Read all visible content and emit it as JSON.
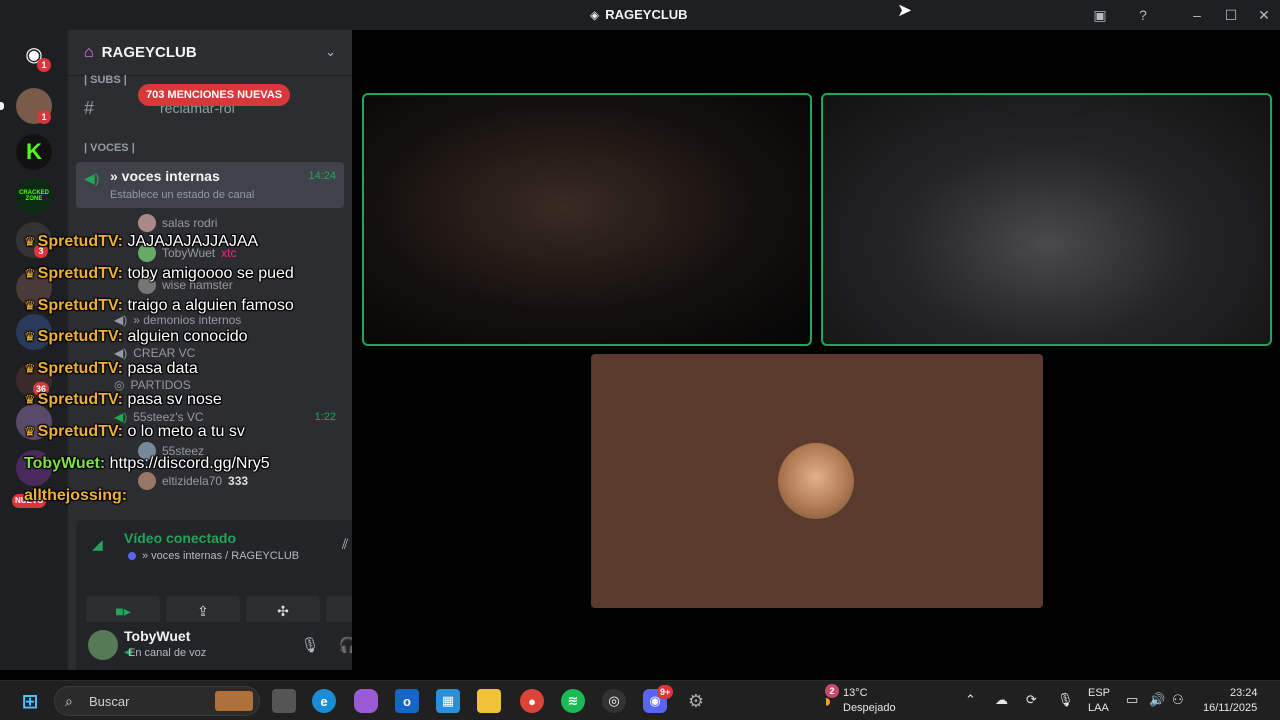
{
  "window": {
    "title": "RAGEYCLUB"
  },
  "guild": {
    "name": "RAGEYCLUB"
  },
  "rail": {
    "badges": [
      "1",
      "1",
      "3",
      "36"
    ],
    "new_label": "NUEVO",
    "cracked_label": "CRACKED ZONE"
  },
  "sidebar": {
    "cat_subs": "| SUBS |",
    "mentions_pill": "703 MENCIONES NUEVAS",
    "hidden_channel": "reclamar-rol",
    "cat_voces": "| VOCES |",
    "active_channel": {
      "name": "» voces internas",
      "time": "14:24",
      "status": "Establece un estado de canal"
    },
    "members": [
      "salas rodri",
      "TobyWuet",
      "wise hamster"
    ],
    "member_tag": "xtc",
    "channels": [
      "» demonios internos",
      "CREAR VC",
      "PARTIDOS",
      "55steez's VC"
    ],
    "vc_time": "1:22",
    "vc_members": [
      "55steez",
      "eltizidela70"
    ],
    "vc_count": "333"
  },
  "chat": [
    {
      "user": "SpretudTV:",
      "text": "JAJAJAJAJJAJAA"
    },
    {
      "user": "SpretudTV:",
      "text": "toby amigoooo se pued"
    },
    {
      "user": "SpretudTV:",
      "text": "traigo a alguien famoso"
    },
    {
      "user": "SpretudTV:",
      "text": "alguien conocido"
    },
    {
      "user": "SpretudTV:",
      "text": "pasa data"
    },
    {
      "user": "SpretudTV:",
      "text": "pasa sv nose"
    },
    {
      "user": "SpretudTV:",
      "text": "o lo meto a tu sv"
    },
    {
      "user": "TobyWuet:",
      "text": "https://discord.gg/Nry5"
    },
    {
      "user": "allthejossing:",
      "text": ""
    }
  ],
  "voice": {
    "connected": "Vídeo conectado",
    "location": "» voces internas / RAGEYCLUB"
  },
  "user": {
    "name": "TobyWuet",
    "status": "En canal de voz"
  },
  "taskbar": {
    "search_placeholder": "Buscar",
    "weather_temp": "13°C",
    "weather_desc": "Despejado",
    "weather_badge": "2",
    "lang_top": "ESP",
    "lang_bottom": "LAA",
    "time": "23:24",
    "date": "16/11/2025",
    "discord_badge": "9+"
  },
  "colors": {
    "speaking": "#23a559",
    "mention": "#da373c",
    "chat_user": "#f0b132"
  },
  "icons": [
    "discord-icon",
    "search-icon",
    "windows-icon",
    "chrome-icon",
    "spotify-icon",
    "edge-icon",
    "folder-icon",
    "gear-icon",
    "mic-icon",
    "headphones-icon",
    "camera-icon",
    "screenshare-icon",
    "activities-icon",
    "soundboard-icon",
    "disconnect-icon",
    "help-icon",
    "inbox-icon"
  ]
}
